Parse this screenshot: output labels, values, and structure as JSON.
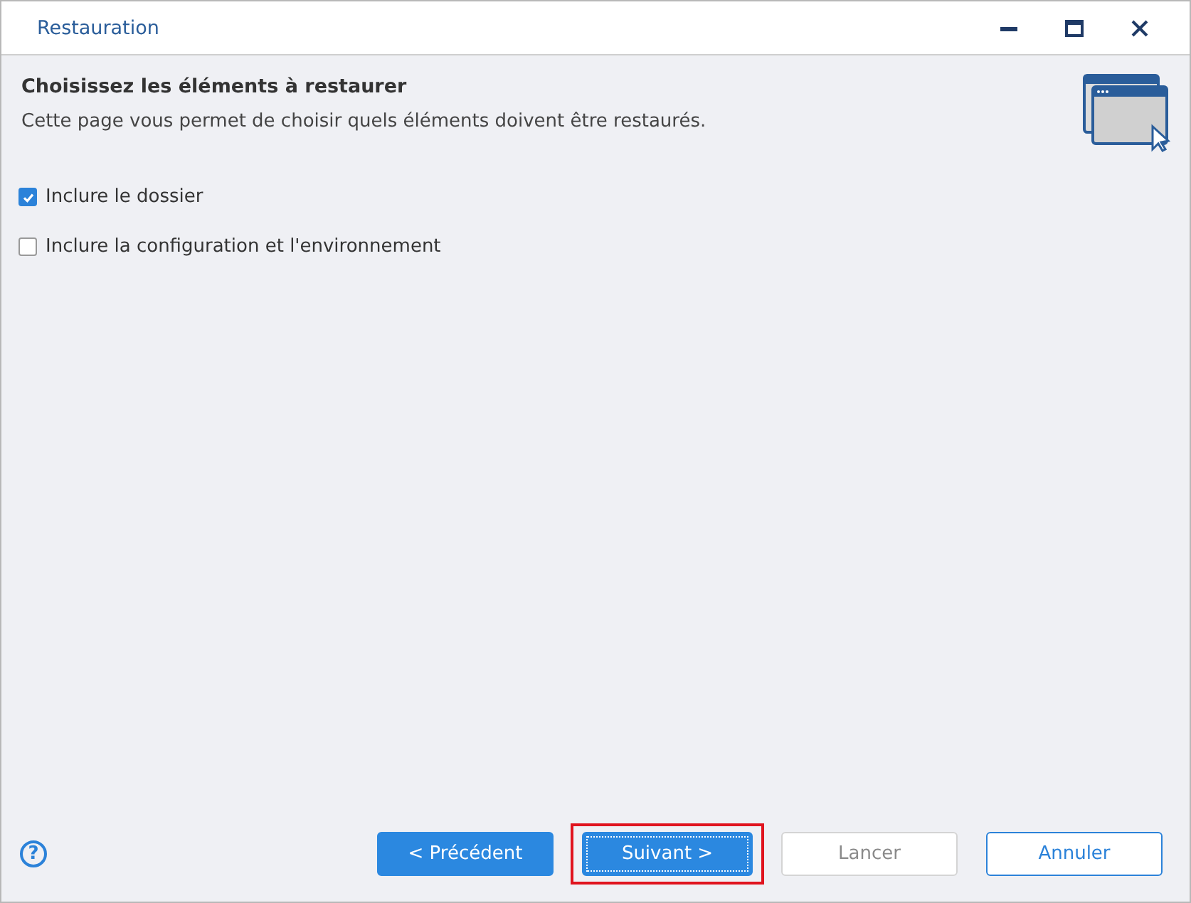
{
  "window": {
    "title": "Restauration"
  },
  "header": {
    "title": "Choisissez les éléments à restaurer",
    "subtitle": "Cette page vous permet de choisir quels éléments doivent être restaurés."
  },
  "options": [
    {
      "label": "Inclure le dossier",
      "checked": true
    },
    {
      "label": "Inclure la configuration et l'environnement",
      "checked": false
    }
  ],
  "help": {
    "symbol": "?"
  },
  "buttons": [
    {
      "label": "< Précédent",
      "kind": "primary",
      "disabled": false,
      "focused": false,
      "highlighted": false
    },
    {
      "label": "Suivant >",
      "kind": "primary",
      "disabled": false,
      "focused": true,
      "highlighted": true
    },
    {
      "label": "Lancer",
      "kind": "secondary",
      "disabled": true,
      "focused": false,
      "highlighted": false
    },
    {
      "label": "Annuler",
      "kind": "secondary",
      "disabled": false,
      "focused": false,
      "highlighted": false
    }
  ]
}
